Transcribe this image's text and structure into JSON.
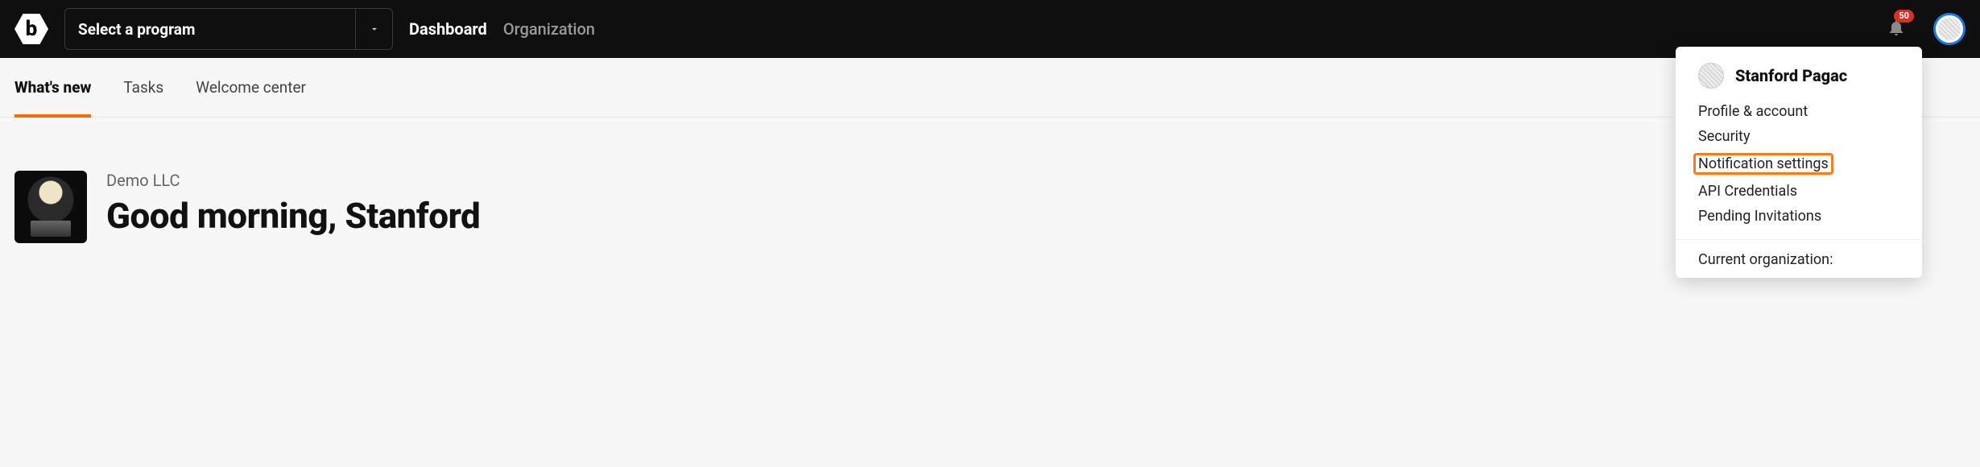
{
  "header": {
    "logo_letter": "b",
    "program_selector_label": "Select a program",
    "nav": [
      {
        "label": "Dashboard",
        "active": true
      },
      {
        "label": "Organization",
        "active": false
      }
    ],
    "notification_count": "50"
  },
  "subtabs": [
    {
      "label": "What's new",
      "active": true
    },
    {
      "label": "Tasks",
      "active": false
    },
    {
      "label": "Welcome center",
      "active": false
    }
  ],
  "main": {
    "org_name": "Demo LLC",
    "greeting": "Good morning, Stanford"
  },
  "user_menu": {
    "name": "Stanford Pagac",
    "items": [
      {
        "label": "Profile & account",
        "highlight": false
      },
      {
        "label": "Security",
        "highlight": false
      },
      {
        "label": "Notification settings",
        "highlight": true
      },
      {
        "label": "API Credentials",
        "highlight": false
      },
      {
        "label": "Pending Invitations",
        "highlight": false
      }
    ],
    "section_label": "Current organization:"
  }
}
